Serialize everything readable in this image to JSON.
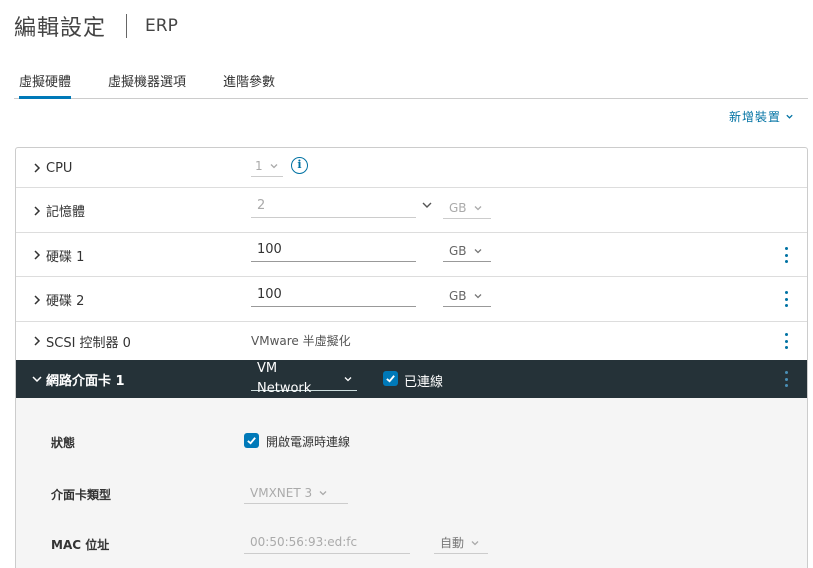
{
  "header": {
    "title": "編輯設定",
    "subtitle": "ERP"
  },
  "tabs": [
    {
      "label": "虛擬硬體",
      "active": true
    },
    {
      "label": "虛擬機器選項",
      "active": false
    },
    {
      "label": "進階參數",
      "active": false
    }
  ],
  "add_device": {
    "label": "新增裝置"
  },
  "rows": {
    "cpu": {
      "label": "CPU",
      "value": "1"
    },
    "memory": {
      "label": "記憶體",
      "value": "2",
      "unit": "GB"
    },
    "disk1": {
      "label": "硬碟 1",
      "value": "100",
      "unit": "GB"
    },
    "disk2": {
      "label": "硬碟 2",
      "value": "100",
      "unit": "GB"
    },
    "scsi": {
      "label": "SCSI 控制器 0",
      "value": "VMware 半虛擬化"
    },
    "nic": {
      "label": "網路介面卡 1",
      "network": "VM Network",
      "connected_label": "已連線",
      "connected": true
    }
  },
  "nic_details": {
    "status": {
      "label": "狀態",
      "option_label": "開啟電源時連線",
      "checked": true
    },
    "adapter_type": {
      "label": "介面卡類型",
      "value": "VMXNET 3"
    },
    "mac": {
      "label": "MAC 位址",
      "value": "00:50:56:93:ed:fc",
      "mode": "自動"
    }
  },
  "colors": {
    "accent": "#0079b8",
    "link": "#0072a3",
    "nic_header_bg": "#253238"
  }
}
